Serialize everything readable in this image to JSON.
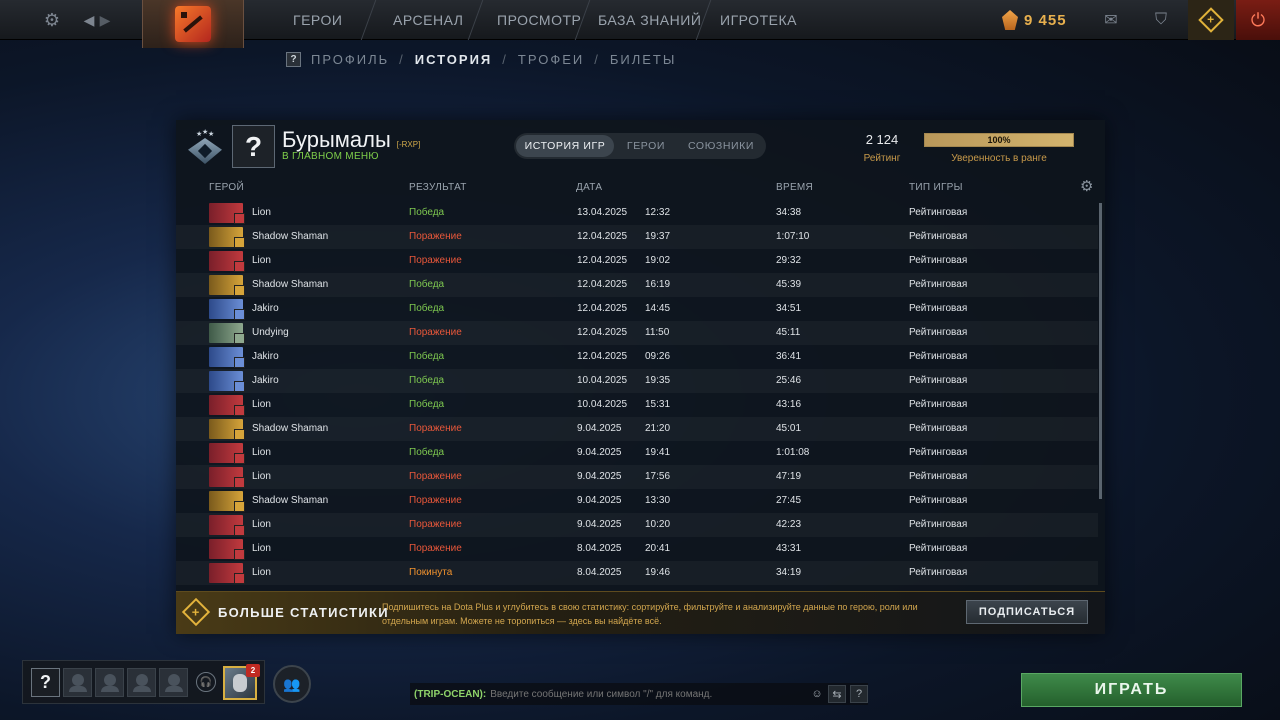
{
  "topbar": {
    "nav": [
      "ГЕРОИ",
      "АРСЕНАЛ",
      "ПРОСМОТР",
      "БАЗА ЗНАНИЙ",
      "ИГРОТЕКА"
    ],
    "currency": "9 455"
  },
  "subnav": {
    "profile": "ПРОФИЛЬ",
    "history": "ИСТОРИЯ",
    "trophies": "ТРОФЕИ",
    "tickets": "БИЛЕТЫ"
  },
  "profile": {
    "avatar": "?",
    "name": "Бурымалы",
    "tag": "[-RXP]",
    "status": "В ГЛАВНОМ МЕНЮ",
    "tabs": [
      "ИСТОРИЯ ИГР",
      "ГЕРОИ",
      "СОЮЗНИКИ"
    ],
    "rating": "2 124",
    "rating_label": "Рейтинг",
    "confidence": "100%",
    "confidence_value": 1.0,
    "confidence_label": "Уверенность в ранге"
  },
  "table": {
    "columns": [
      "ГЕРОЙ",
      "РЕЗУЛЬТАТ",
      "ДАТА",
      "ВРЕМЯ",
      "ТИП ИГРЫ"
    ],
    "rows": [
      {
        "hero": "Lion",
        "result": "Победа",
        "date": "13.04.2025",
        "time": "12:32",
        "duration": "34:38",
        "type": "Рейтинговая"
      },
      {
        "hero": "Shadow Shaman",
        "result": "Поражение",
        "date": "12.04.2025",
        "time": "19:37",
        "duration": "1:07:10",
        "type": "Рейтинговая"
      },
      {
        "hero": "Lion",
        "result": "Поражение",
        "date": "12.04.2025",
        "time": "19:02",
        "duration": "29:32",
        "type": "Рейтинговая"
      },
      {
        "hero": "Shadow Shaman",
        "result": "Победа",
        "date": "12.04.2025",
        "time": "16:19",
        "duration": "45:39",
        "type": "Рейтинговая"
      },
      {
        "hero": "Jakiro",
        "result": "Победа",
        "date": "12.04.2025",
        "time": "14:45",
        "duration": "34:51",
        "type": "Рейтинговая"
      },
      {
        "hero": "Undying",
        "result": "Поражение",
        "date": "12.04.2025",
        "time": "11:50",
        "duration": "45:11",
        "type": "Рейтинговая"
      },
      {
        "hero": "Jakiro",
        "result": "Победа",
        "date": "12.04.2025",
        "time": "09:26",
        "duration": "36:41",
        "type": "Рейтинговая"
      },
      {
        "hero": "Jakiro",
        "result": "Победа",
        "date": "10.04.2025",
        "time": "19:35",
        "duration": "25:46",
        "type": "Рейтинговая"
      },
      {
        "hero": "Lion",
        "result": "Победа",
        "date": "10.04.2025",
        "time": "15:31",
        "duration": "43:16",
        "type": "Рейтинговая"
      },
      {
        "hero": "Shadow Shaman",
        "result": "Поражение",
        "date": "9.04.2025",
        "time": "21:20",
        "duration": "45:01",
        "type": "Рейтинговая"
      },
      {
        "hero": "Lion",
        "result": "Победа",
        "date": "9.04.2025",
        "time": "19:41",
        "duration": "1:01:08",
        "type": "Рейтинговая"
      },
      {
        "hero": "Lion",
        "result": "Поражение",
        "date": "9.04.2025",
        "time": "17:56",
        "duration": "47:19",
        "type": "Рейтинговая"
      },
      {
        "hero": "Shadow Shaman",
        "result": "Поражение",
        "date": "9.04.2025",
        "time": "13:30",
        "duration": "27:45",
        "type": "Рейтинговая"
      },
      {
        "hero": "Lion",
        "result": "Поражение",
        "date": "9.04.2025",
        "time": "10:20",
        "duration": "42:23",
        "type": "Рейтинговая"
      },
      {
        "hero": "Lion",
        "result": "Поражение",
        "date": "8.04.2025",
        "time": "20:41",
        "duration": "43:31",
        "type": "Рейтинговая"
      },
      {
        "hero": "Lion",
        "result": "Покинута",
        "date": "8.04.2025",
        "time": "19:46",
        "duration": "34:19",
        "type": "Рейтинговая"
      }
    ]
  },
  "banner": {
    "title": "БОЛЬШЕ СТАТИСТИКИ",
    "description": "Подпишитесь на Dota Plus и углубитесь в свою статистику: сортируйте, фильтруйте и анализируйте данные по герою, роли или отдельным играм. Можете не торопиться — здесь вы найдёте всё.",
    "button": "ПОДПИСАТЬСЯ"
  },
  "party": {
    "slot_label": "?",
    "friend_badge": "2"
  },
  "chat": {
    "channel": "(TRIP-OCEAN):",
    "placeholder": "Введите сообщение или символ \"/\" для команд.",
    "help": "?"
  },
  "play_button": "ИГРАТЬ",
  "colors": {
    "win": "#7ec850",
    "loss": "#e8573a",
    "abandon": "#f0922e",
    "accent_gold": "#e0b23a",
    "play_green": "#3f8a4a"
  },
  "icons": {
    "settings": "gear-icon",
    "back": "back-arrow-icon",
    "forward": "forward-arrow-icon",
    "mail": "mail-icon",
    "armory": "armory-icon",
    "dota_plus": "plus-diamond-icon",
    "power": "power-icon",
    "headset": "headset-icon",
    "group": "group-icon",
    "smiley": "smiley-icon",
    "screenshot": "screenshot-icon"
  },
  "hero_art": {
    "Lion": [
      "#7a1f2a",
      "#c13a3e"
    ],
    "Shadow Shaman": [
      "#7a5a1c",
      "#d6a43a"
    ],
    "Jakiro": [
      "#2d4a8a",
      "#6b8ed6"
    ],
    "Undying": [
      "#3f5a48",
      "#8ea88e"
    ]
  }
}
